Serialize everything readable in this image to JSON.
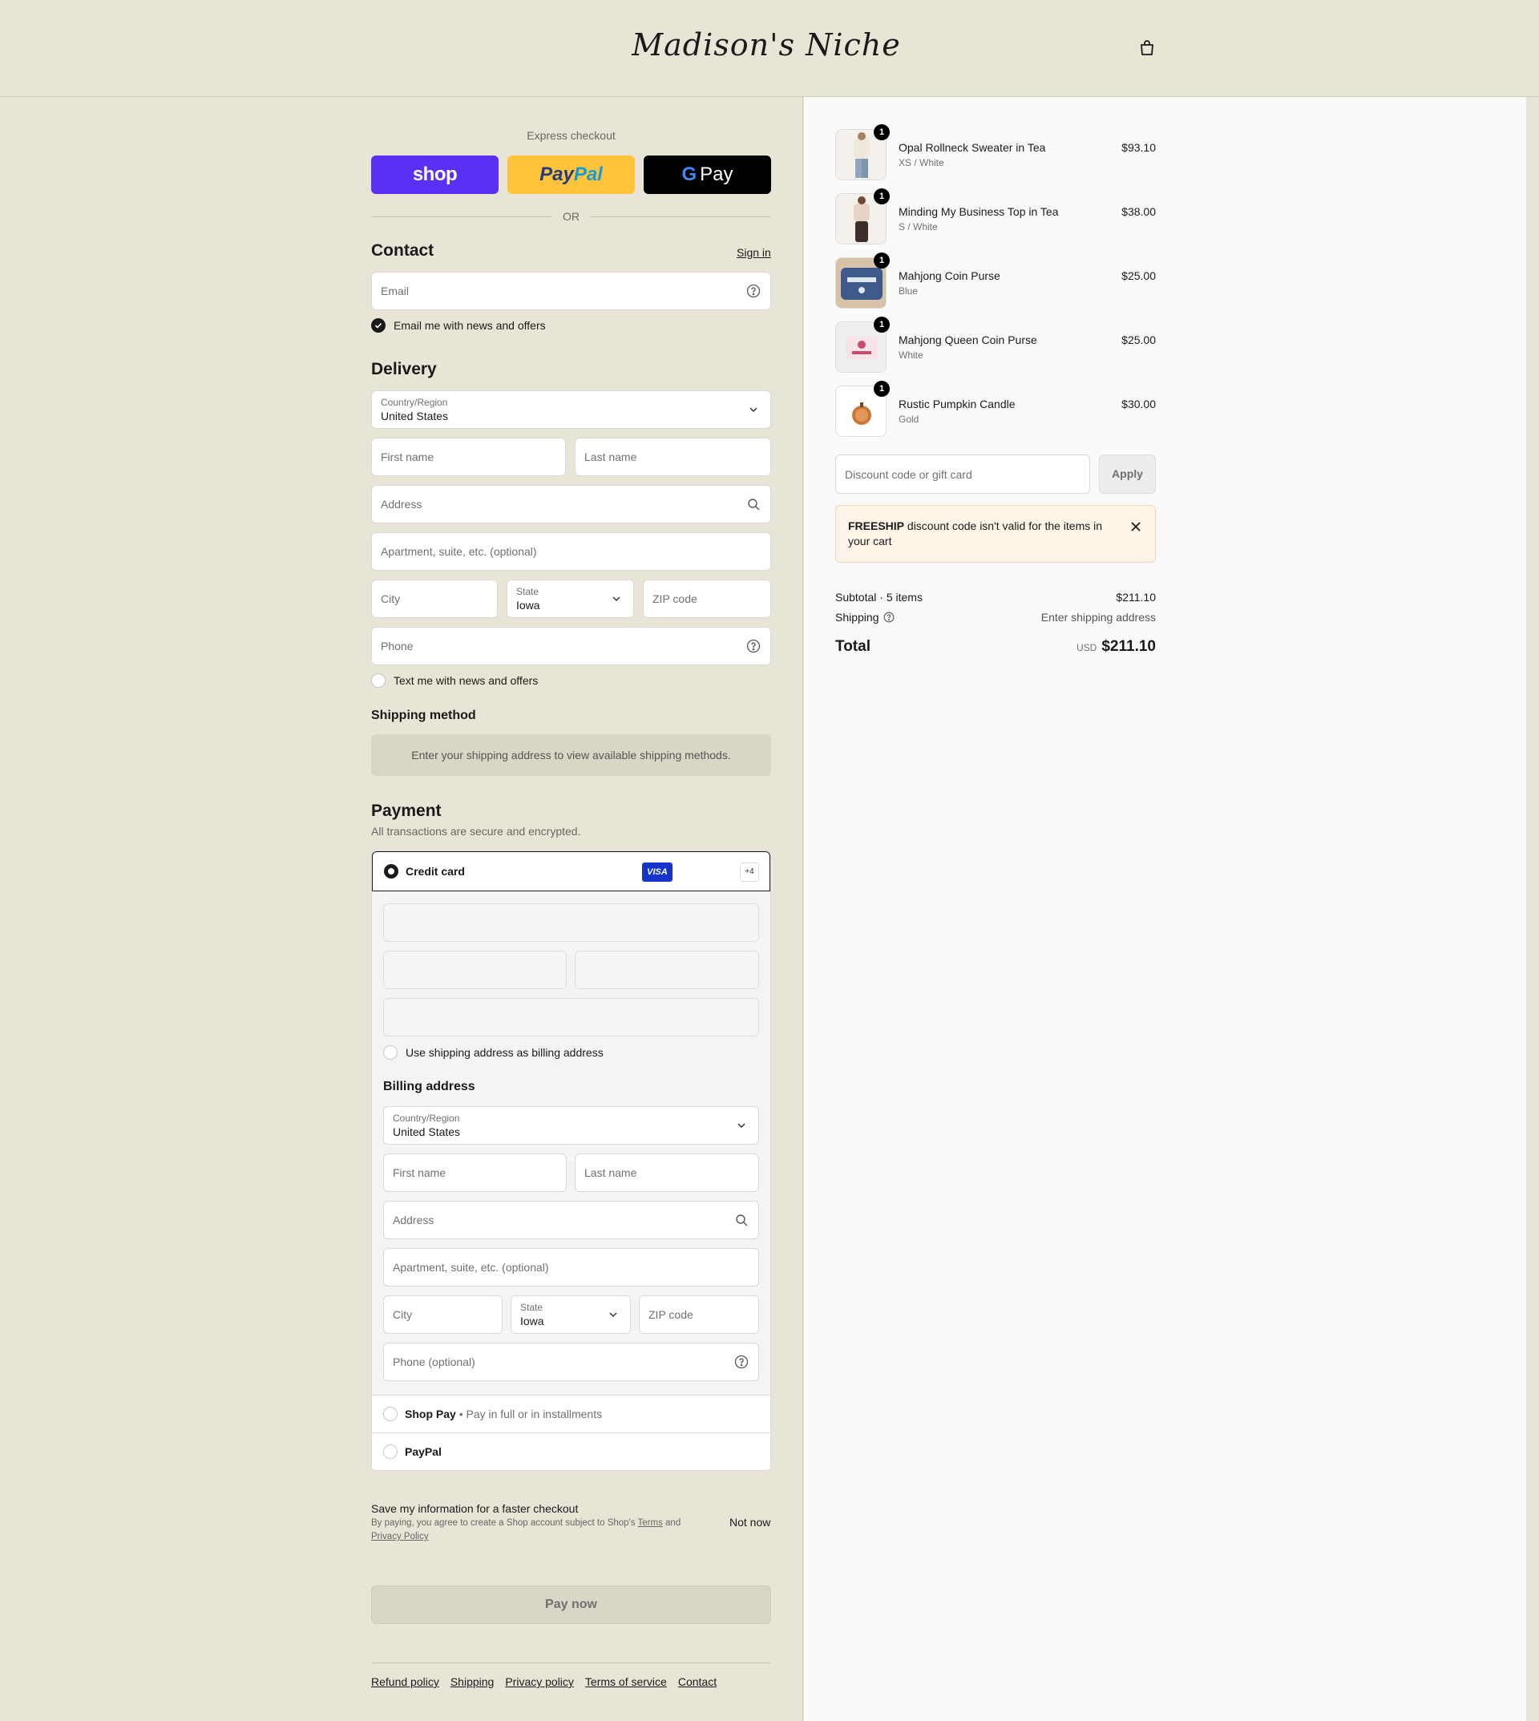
{
  "header": {
    "logo": "Madison's Niche"
  },
  "express": {
    "label": "Express checkout",
    "shop": "shop",
    "paypal_a": "Pay",
    "paypal_b": "Pal",
    "gpay_g": "G",
    "gpay": "Pay",
    "or": "OR"
  },
  "contact": {
    "title": "Contact",
    "sign_in": "Sign in",
    "email_placeholder": "Email",
    "news_label": "Email me with news and offers",
    "news_checked": true
  },
  "delivery": {
    "title": "Delivery",
    "country_label": "Country/Region",
    "country": "United States",
    "first_name": "First name",
    "last_name": "Last name",
    "address": "Address",
    "apartment": "Apartment, suite, etc. (optional)",
    "city": "City",
    "state_label": "State",
    "state": "Iowa",
    "zip": "ZIP code",
    "phone": "Phone",
    "text_label": "Text me with news and offers"
  },
  "shipping_method": {
    "title": "Shipping method",
    "message": "Enter your shipping address to view available shipping methods."
  },
  "payment": {
    "title": "Payment",
    "subtitle": "All transactions are secure and encrypted.",
    "credit_card": "Credit card",
    "visa": "VISA",
    "more_cards": "+4",
    "use_shipping": "Use shipping address as billing address",
    "billing_title": "Billing address",
    "billing": {
      "country_label": "Country/Region",
      "country": "United States",
      "first_name": "First name",
      "last_name": "Last name",
      "address": "Address",
      "apartment": "Apartment, suite, etc. (optional)",
      "city": "City",
      "state_label": "State",
      "state": "Iowa",
      "zip": "ZIP code",
      "phone": "Phone (optional)"
    },
    "shop_pay": "Shop Pay",
    "shop_pay_sub": "• Pay in full or in installments",
    "paypal": "PayPal"
  },
  "save": {
    "title": "Save my information for a faster checkout",
    "sub_prefix": "By paying, you agree to create a Shop account subject to Shop's ",
    "terms": "Terms",
    "and": " and ",
    "privacy": "Privacy Policy",
    "not_now": "Not now"
  },
  "pay_now": "Pay now",
  "footer": [
    "Refund policy",
    "Shipping",
    "Privacy policy",
    "Terms of service",
    "Contact"
  ],
  "cart": {
    "items": [
      {
        "name": "Opal Rollneck Sweater in Tea",
        "variant": "XS / White",
        "price": "$93.10",
        "qty": "1"
      },
      {
        "name": "Minding My Business Top in Tea",
        "variant": "S / White",
        "price": "$38.00",
        "qty": "1"
      },
      {
        "name": "Mahjong Coin Purse",
        "variant": "Blue",
        "price": "$25.00",
        "qty": "1"
      },
      {
        "name": "Mahjong Queen Coin Purse",
        "variant": "White",
        "price": "$25.00",
        "qty": "1"
      },
      {
        "name": "Rustic Pumpkin Candle",
        "variant": "Gold",
        "price": "$30.00",
        "qty": "1"
      }
    ],
    "discount_placeholder": "Discount code or gift card",
    "apply": "Apply",
    "alert_code": "FREESHIP",
    "alert_msg": " discount code isn't valid for the items in your cart",
    "subtotal_label": "Subtotal · 5 items",
    "subtotal": "$211.10",
    "shipping_label": "Shipping",
    "shipping_value": "Enter shipping address",
    "total_label": "Total",
    "currency": "USD",
    "total": "$211.10"
  },
  "colors": {
    "shop_purple": "#5a31f4",
    "paypal_yellow": "#ffc439",
    "page_bg": "#e8e5d6",
    "visa_blue": "#1434cb"
  }
}
